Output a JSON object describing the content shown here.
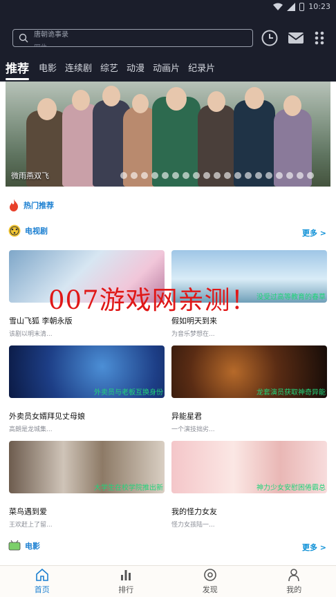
{
  "status": {
    "time": "10:23"
  },
  "search": {
    "placeholder_line1": "唐朝诡事录",
    "placeholder_line2": "四仇"
  },
  "tabs": [
    {
      "label": "推荐",
      "active": true
    },
    {
      "label": "电影"
    },
    {
      "label": "连续剧"
    },
    {
      "label": "综艺"
    },
    {
      "label": "动漫"
    },
    {
      "label": "动画片"
    },
    {
      "label": "纪录片"
    }
  ],
  "banner": {
    "caption": "微雨燕双飞",
    "slide_count": 19
  },
  "sections": {
    "hot": {
      "title": "热门推荐"
    },
    "tv": {
      "title": "电视剧",
      "more": "更多 >"
    },
    "movie": {
      "title": "电影",
      "more": "更多 >"
    }
  },
  "cards": [
    {
      "title": "雪山飞狐 李朝永版",
      "desc": "该剧以明末清...",
      "tag": ""
    },
    {
      "title": "假如明天到来",
      "desc": "为音乐梦想在...",
      "tag": "没受过高等教育的春草"
    },
    {
      "title": "外卖员女婿拜见丈母娘",
      "desc": "高朗是龙城集...",
      "tag": "外卖员与老板互换身份"
    },
    {
      "title": "异能星君",
      "desc": "一个演技拙劣...",
      "tag": "龙套演员获取神奇异能"
    },
    {
      "title": "菜鸟遇到爱",
      "desc": "王欢赶上了留...",
      "tag": "大学生在校学院推出新"
    },
    {
      "title": "我的怪力女友",
      "desc": "怪力女孩陆一...",
      "tag": "神力少女安慰困倦霸总"
    }
  ],
  "watermark": "007游戏网亲测！",
  "bottom_nav": [
    {
      "label": "首页",
      "active": true
    },
    {
      "label": "排行"
    },
    {
      "label": "发现"
    },
    {
      "label": "我的"
    }
  ],
  "colors": {
    "header_bg": "#1b1e2b",
    "accent": "#1b7fd1",
    "more_link": "#0b8fd6",
    "watermark": "#e01818"
  }
}
